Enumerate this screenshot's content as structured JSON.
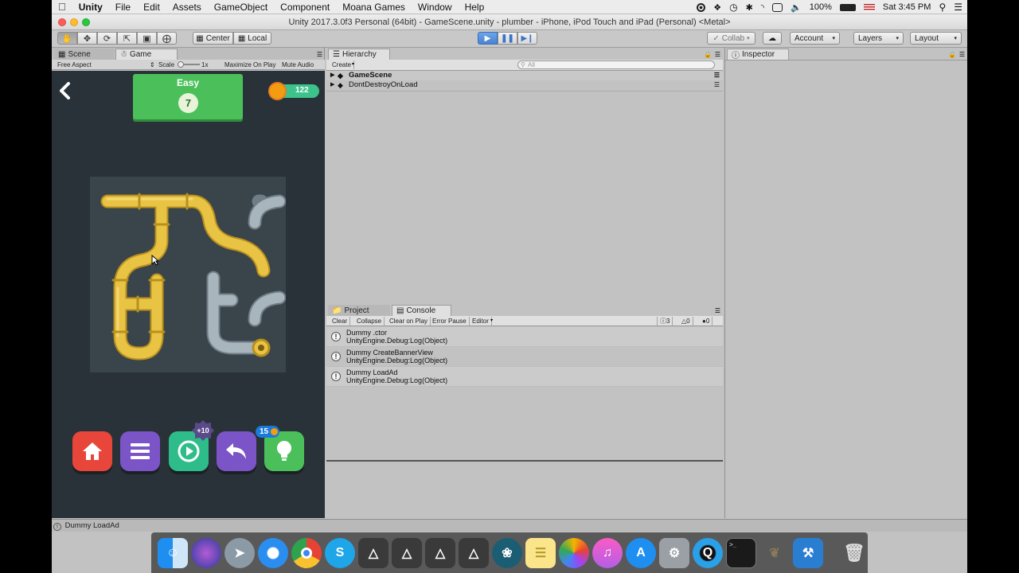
{
  "menubar": {
    "apple": "",
    "app": "Unity",
    "items": [
      "File",
      "Edit",
      "Assets",
      "GameObject",
      "Component",
      "Moana Games",
      "Window",
      "Help"
    ],
    "battery": "100%",
    "clock": "Sat 3:45 PM"
  },
  "window": {
    "title": "Unity 2017.3.0f3 Personal (64bit) - GameScene.unity - plumber - iPhone, iPod Touch and iPad (Personal) <Metal>"
  },
  "toolbar": {
    "pivot_center": "Center",
    "pivot_local": "Local",
    "collab": "Collab",
    "account": "Account",
    "layers": "Layers",
    "layout": "Layout"
  },
  "tabs": {
    "scene": "Scene",
    "game": "Game",
    "hierarchy": "Hierarchy",
    "project": "Project",
    "console": "Console",
    "inspector": "Inspector"
  },
  "gamebar": {
    "aspect": "Free Aspect",
    "scale_label": "Scale",
    "scale_value": "1x",
    "maximize": "Maximize On Play",
    "mute": "Mute Audio"
  },
  "game": {
    "level_title": "Easy",
    "level_number": "7",
    "coins": "122",
    "video_bonus": "+10",
    "hint_count": "15"
  },
  "hierarchy": {
    "create": "Create",
    "search_placeholder": "All",
    "items": [
      "GameScene",
      "DontDestroyOnLoad"
    ]
  },
  "console": {
    "buttons": [
      "Clear",
      "Collapse",
      "Clear on Play",
      "Error Pause",
      "Editor"
    ],
    "log_count": "3",
    "warn_count": "0",
    "error_count": "0",
    "entries": [
      {
        "line1": "Dummy .ctor",
        "line2": "UnityEngine.Debug:Log(Object)"
      },
      {
        "line1": "Dummy CreateBannerView",
        "line2": "UnityEngine.Debug:Log(Object)"
      },
      {
        "line1": "Dummy LoadAd",
        "line2": "UnityEngine.Debug:Log(Object)"
      }
    ]
  },
  "status": {
    "message": "Dummy LoadAd"
  },
  "colors": {
    "pipe_gold": "#e3b936",
    "pipe_gray": "#8d9aa3",
    "green": "#4bc05a",
    "home_red": "#e8463a",
    "menu_purple": "#7b54c7",
    "play_green": "#2ebd8a"
  },
  "dock": {
    "apps": [
      "finder-icon",
      "siri-icon",
      "launchpad-icon",
      "safari-icon",
      "chrome-icon",
      "skype-icon",
      "unity-icon",
      "unity-icon",
      "unity-icon",
      "unity-icon",
      "sourcetree-icon",
      "notes-icon",
      "photos-icon",
      "itunes-icon",
      "appstore-icon",
      "system-preferences-icon",
      "quicktime-icon",
      "terminal-icon",
      "gimp-icon",
      "xcode-icon",
      "trash-icon"
    ]
  }
}
